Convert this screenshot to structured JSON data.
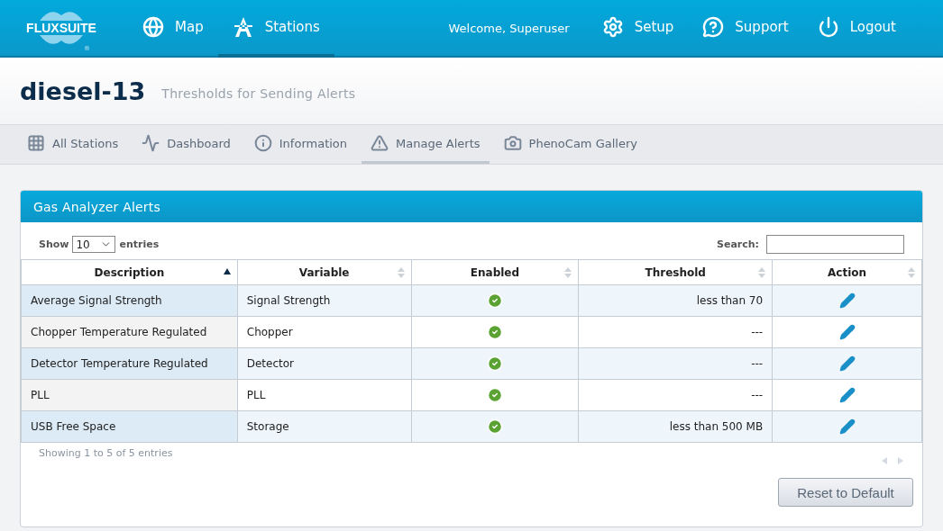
{
  "logo": {
    "text": "FLUXSUITE",
    "mark": "®"
  },
  "nav": [
    {
      "label": "Map",
      "selected": false
    },
    {
      "label": "Stations",
      "selected": true
    }
  ],
  "welcome": "Welcome, Superuser",
  "user_nav": [
    {
      "label": "Setup"
    },
    {
      "label": "Support"
    },
    {
      "label": "Logout"
    }
  ],
  "page": {
    "title": "diesel-13",
    "subtitle": "Thresholds for Sending Alerts"
  },
  "subnav": [
    {
      "label": "All Stations",
      "selected": false
    },
    {
      "label": "Dashboard",
      "selected": false
    },
    {
      "label": "Information",
      "selected": false
    },
    {
      "label": "Manage Alerts",
      "selected": true
    },
    {
      "label": "PhenoCam Gallery",
      "selected": false
    }
  ],
  "panel": {
    "title": "Gas Analyzer Alerts",
    "show_label": "Show",
    "page_size": "10",
    "entries_label": "entries",
    "search_label": "Search:",
    "table": {
      "columns": [
        {
          "label": "Description",
          "sorted": true
        },
        {
          "label": "Variable",
          "sorted": false
        },
        {
          "label": "Enabled",
          "sorted": false
        },
        {
          "label": "Threshold",
          "sorted": false
        },
        {
          "label": "Action",
          "sorted": false
        }
      ],
      "rows": [
        {
          "description": "Average Signal Strength",
          "variable": "Signal Strength",
          "enabled": true,
          "threshold": "less than 70"
        },
        {
          "description": "Chopper Temperature Regulated",
          "variable": "Chopper",
          "enabled": true,
          "threshold": "---"
        },
        {
          "description": "Detector Temperature Regulated",
          "variable": "Detector",
          "enabled": true,
          "threshold": "---"
        },
        {
          "description": "PLL",
          "variable": "PLL",
          "enabled": true,
          "threshold": "---"
        },
        {
          "description": "USB Free Space",
          "variable": "Storage",
          "enabled": true,
          "threshold": "less than 500 MB"
        }
      ]
    },
    "info": "Showing 1 to 5 of 5 entries",
    "reset_button": "Reset to Default"
  }
}
